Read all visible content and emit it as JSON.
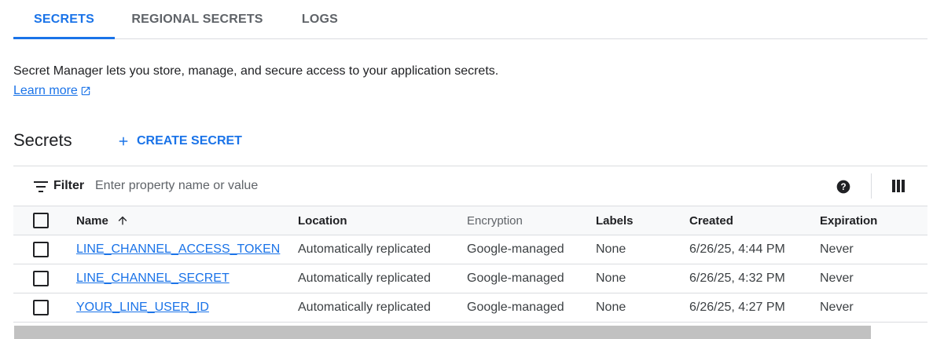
{
  "tabs": [
    {
      "label": "SECRETS",
      "active": true
    },
    {
      "label": "REGIONAL SECRETS",
      "active": false
    },
    {
      "label": "LOGS",
      "active": false
    }
  ],
  "intro": {
    "description": "Secret Manager lets you store, manage, and secure access to your application secrets.",
    "learn_more": "Learn more"
  },
  "section": {
    "title": "Secrets",
    "create_label": "CREATE SECRET"
  },
  "filter": {
    "label": "Filter",
    "placeholder": "Enter property name or value"
  },
  "table": {
    "columns": [
      "Name",
      "Location",
      "Encryption",
      "Labels",
      "Created",
      "Expiration"
    ],
    "rows": [
      {
        "name": "LINE_CHANNEL_ACCESS_TOKEN",
        "location": "Automatically replicated",
        "encryption": "Google-managed",
        "labels": "None",
        "created": "6/26/25, 4:44 PM",
        "expiration": "Never"
      },
      {
        "name": "LINE_CHANNEL_SECRET",
        "location": "Automatically replicated",
        "encryption": "Google-managed",
        "labels": "None",
        "created": "6/26/25, 4:32 PM",
        "expiration": "Never"
      },
      {
        "name": "YOUR_LINE_USER_ID",
        "location": "Automatically replicated",
        "encryption": "Google-managed",
        "labels": "None",
        "created": "6/26/25, 4:27 PM",
        "expiration": "Never"
      }
    ]
  },
  "icons": {
    "open_in_new": "open-in-new-icon",
    "add": "plus-icon",
    "filter": "filter-icon",
    "help": "help-icon",
    "columns": "column-display-icon",
    "sort": "arrow-up-icon"
  },
  "colors": {
    "accent": "#1a73e8",
    "text": "#202124",
    "muted": "#5f6368",
    "divider": "#dadce0",
    "header_bg": "#f8f9fa"
  }
}
